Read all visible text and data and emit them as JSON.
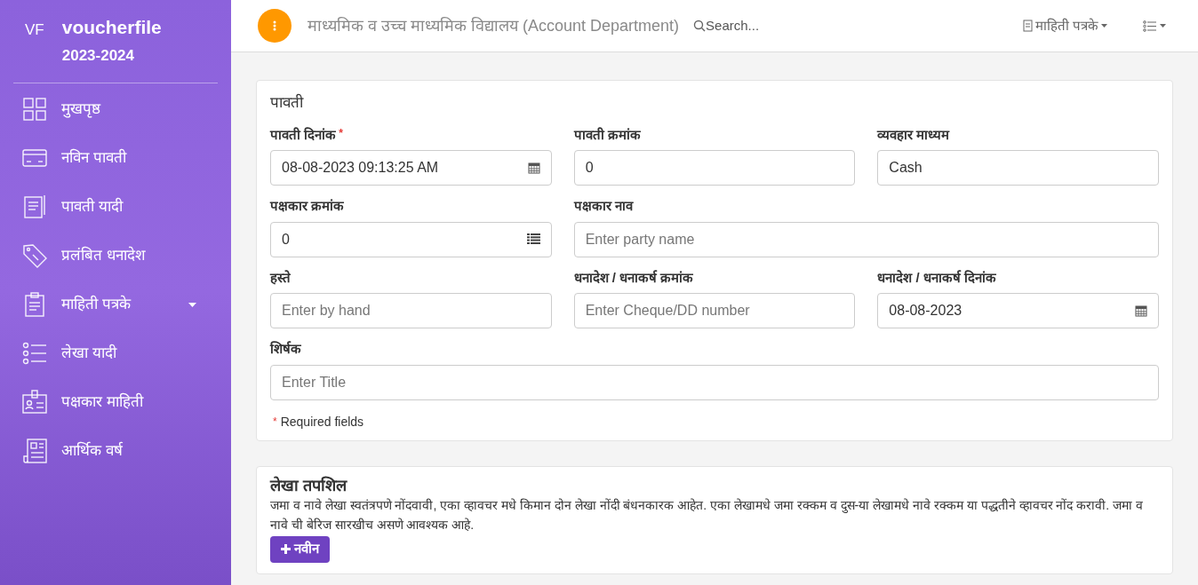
{
  "sidebar": {
    "logo_mark": "VF",
    "brand": "voucherfile",
    "year": "2023-2024",
    "items": [
      {
        "label": "मुखपृष्ठ",
        "dropdown": false
      },
      {
        "label": "नविन पावती",
        "dropdown": false
      },
      {
        "label": "पावती यादी",
        "dropdown": false
      },
      {
        "label": "प्रलंबित धनादेश",
        "dropdown": false
      },
      {
        "label": "माहिती पत्रके",
        "dropdown": true
      },
      {
        "label": "लेखा यादी",
        "dropdown": false
      },
      {
        "label": "पक्षकार माहिती",
        "dropdown": false
      },
      {
        "label": "आर्थिक वर्ष",
        "dropdown": false
      }
    ]
  },
  "topbar": {
    "title": "माध्यमिक व उच्च माध्यमिक विद्यालय (Account Department)",
    "search_placeholder": "Search...",
    "reports_menu": "माहिती पत्रके"
  },
  "receipt_card": {
    "title": "पावती",
    "rows": [
      [
        {
          "label": "पावती दिनांक",
          "required": true,
          "kind": "date",
          "value": "08-08-2023 09:13:25 AM"
        },
        {
          "label": "पावती क्रमांक",
          "required": false,
          "kind": "text",
          "value": "0"
        },
        {
          "label": "व्यवहार माध्यम",
          "required": false,
          "kind": "text",
          "value": "Cash"
        }
      ],
      [
        {
          "label": "पक्षकार क्रमांक",
          "required": false,
          "kind": "list",
          "value": "0"
        },
        {
          "label": "पक्षकार नाव",
          "required": false,
          "kind": "text",
          "placeholder": "Enter party name"
        }
      ],
      [
        {
          "label": "हस्ते",
          "required": false,
          "kind": "text",
          "placeholder": "Enter by hand"
        },
        {
          "label": "धनादेश / धनाकर्ष क्रमांक",
          "required": false,
          "kind": "text",
          "placeholder": "Enter Cheque/DD number"
        },
        {
          "label": "धनादेश / धनाकर्ष दिनांक",
          "required": false,
          "kind": "date",
          "value": "08-08-2023"
        }
      ],
      [
        {
          "label": "शिर्षक",
          "required": false,
          "kind": "text",
          "placeholder": "Enter Title"
        }
      ]
    ],
    "required_mark": "*",
    "required_note": "Required fields"
  },
  "accounts_card": {
    "title": "लेखा तपशिल",
    "description": "जमा व नावे लेखा स्वतंत्रपणे नोंदवावी, एका व्हावचर मधे किमान दोन लेखा नोंदी बंधनकारक आहेत. एका लेखामधे जमा रक्कम व दुस-या लेखामधे नावे रक्कम या पद्धतीने व्हावचर नोंद करावी. जमा व नावे ची बेरिज सारखीच असणे आवश्यक आहे.",
    "add_button": "नवीन"
  }
}
